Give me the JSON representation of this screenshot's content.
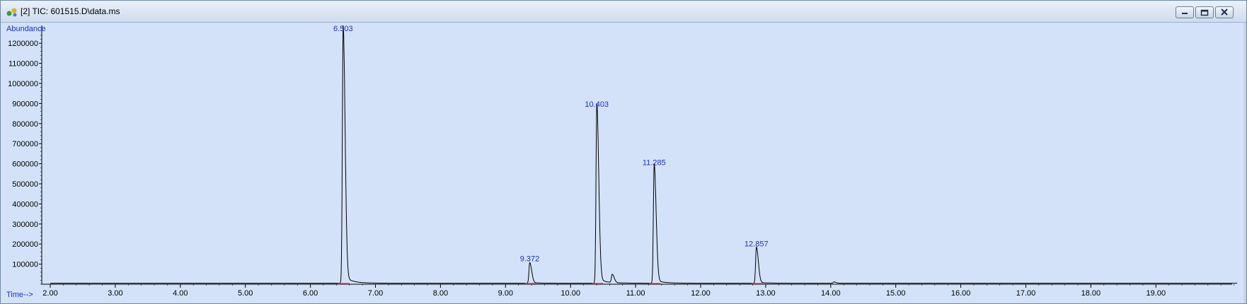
{
  "window": {
    "title": "[2] TIC: 601515.D\\data.ms",
    "controls": [
      "minimize-icon",
      "restore-icon",
      "close-icon"
    ]
  },
  "colors": {
    "plot_background": "#d3e2f9",
    "trace": "#000000",
    "peak_label": "#1a2fc8",
    "axis_label": "#1a2fc8",
    "baseline_marker": "#e0405a"
  },
  "chart_data": {
    "type": "line",
    "title": "",
    "ylabel": "Abundance",
    "xlabel": "Time-->",
    "xlim": [
      1.9,
      20.3
    ],
    "ylim": [
      0,
      1250000
    ],
    "x_ticks": [
      "2.00",
      "3.00",
      "4.00",
      "5.00",
      "6.00",
      "7.00",
      "8.00",
      "9.00",
      "10.00",
      "11.00",
      "12.00",
      "13.00",
      "14.00",
      "15.00",
      "16.00",
      "17.00",
      "18.00",
      "19.00"
    ],
    "y_ticks": [
      "100000",
      "200000",
      "300000",
      "400000",
      "500000",
      "600000",
      "700000",
      "800000",
      "900000",
      "1000000",
      "1100000",
      "1200000"
    ],
    "grid": false,
    "baseline": 5000,
    "peaks": [
      {
        "label": "6.503",
        "rt": 6.503,
        "height": 1250000
      },
      {
        "label": "9.372",
        "rt": 9.372,
        "height": 100000
      },
      {
        "label": "10.403",
        "rt": 10.403,
        "height": 870000
      },
      {
        "label": "11.285",
        "rt": 11.285,
        "height": 580000
      },
      {
        "label": "12.857",
        "rt": 12.857,
        "height": 175000
      }
    ],
    "minor_peaks": [
      {
        "rt": 10.64,
        "height": 40000
      },
      {
        "rt": 14.05,
        "height": 6000
      }
    ]
  }
}
